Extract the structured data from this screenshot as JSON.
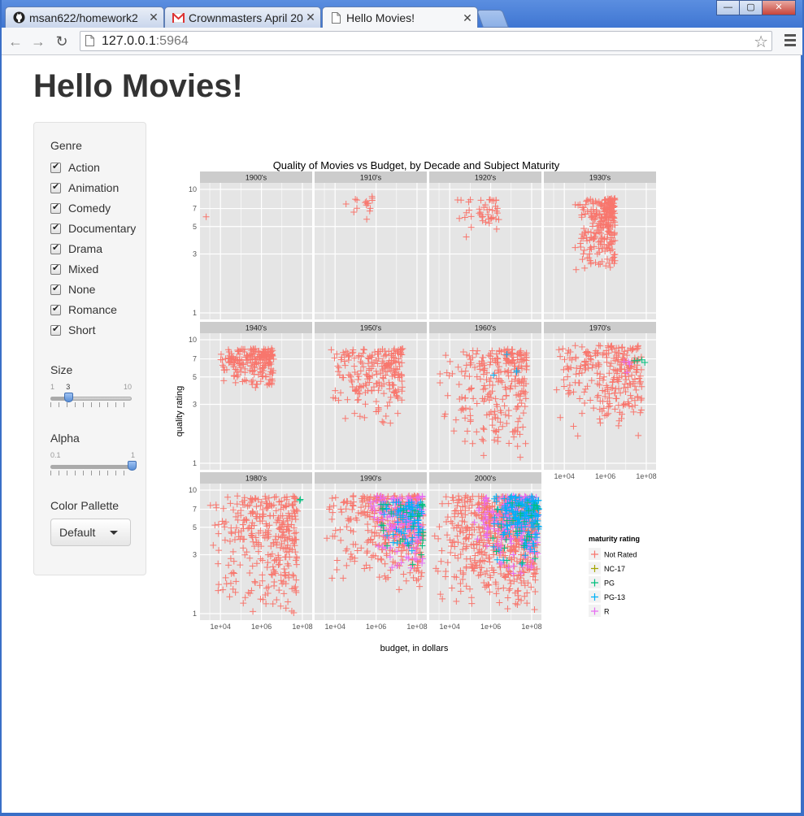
{
  "browser": {
    "tabs": [
      {
        "label": "msan622/homework2",
        "icon": "github-icon"
      },
      {
        "label": "Crownmasters April 20",
        "icon": "gmail-icon"
      },
      {
        "label": "Hello Movies!",
        "icon": "page-icon"
      }
    ],
    "url_host": "127.0.0.1",
    "url_port": ":5964"
  },
  "page": {
    "title": "Hello Movies!"
  },
  "sidebar": {
    "genre_label": "Genre",
    "genres": [
      "Action",
      "Animation",
      "Comedy",
      "Documentary",
      "Drama",
      "Mixed",
      "None",
      "Romance",
      "Short"
    ],
    "size": {
      "label": "Size",
      "min": "1",
      "max": "10",
      "value": "3",
      "fraction": 0.222
    },
    "alpha": {
      "label": "Alpha",
      "min": "0.1",
      "max": "1",
      "value": "1",
      "fraction": 1.0
    },
    "palette": {
      "label": "Color Pallette",
      "selected": "Default"
    }
  },
  "colors": {
    "not_rated": "#f8766d",
    "nc17": "#a3a500",
    "pg": "#00bf7d",
    "pg13": "#00b0f6",
    "r": "#e76bf3",
    "panel_bg": "#e5e5e5",
    "strip_bg": "#cccccc"
  },
  "chart_data": {
    "type": "scatter",
    "title": "Quality of Movies vs Budget, by Decade and Subject Maturity",
    "xlabel": "budget, in dollars",
    "ylabel": "quality rating",
    "x_scale": "log10",
    "y_scale": "log10",
    "xlim": [
      1000,
      300000000
    ],
    "ylim": [
      1,
      10
    ],
    "x_ticks": [
      "1e+04",
      "1e+06",
      "1e+08"
    ],
    "y_ticks": [
      "1",
      "3",
      "5",
      "7",
      "10"
    ],
    "facets": [
      "1900's",
      "1910's",
      "1920's",
      "1930's",
      "1940's",
      "1950's",
      "1960's",
      "1970's",
      "1980's",
      "1990's",
      "2000's"
    ],
    "legend": {
      "title": "maturity rating",
      "entries": [
        "Not Rated",
        "NC-17",
        "PG",
        "PG-13",
        "R"
      ]
    },
    "clusters": [
      {
        "facet": "1900's",
        "rating": "Not Rated",
        "n": 1,
        "x": [
          2000,
          2000
        ],
        "y": [
          6,
          6
        ]
      },
      {
        "facet": "1910's",
        "rating": "Not Rated",
        "n": 16,
        "x": [
          8000,
          800000
        ],
        "y": [
          5,
          9
        ]
      },
      {
        "facet": "1920's",
        "rating": "Not Rated",
        "n": 45,
        "x": [
          20000,
          2500000
        ],
        "y": [
          4,
          8.5
        ]
      },
      {
        "facet": "1930's",
        "rating": "Not Rated",
        "n": 260,
        "x": [
          30000,
          3000000
        ],
        "y": [
          2,
          8.5
        ]
      },
      {
        "facet": "1940's",
        "rating": "Not Rated",
        "n": 220,
        "x": [
          10000,
          4000000
        ],
        "y": [
          4,
          8.5
        ]
      },
      {
        "facet": "1950's",
        "rating": "Not Rated",
        "n": 220,
        "x": [
          4000,
          20000000
        ],
        "y": [
          2,
          8.5
        ]
      },
      {
        "facet": "1960's",
        "rating": "Not Rated",
        "n": 260,
        "x": [
          3000,
          60000000
        ],
        "y": [
          1,
          8.5
        ]
      },
      {
        "facet": "1960's",
        "rating": "PG-13",
        "n": 4,
        "x": [
          100000,
          30000000
        ],
        "y": [
          4,
          8
        ]
      },
      {
        "facet": "1970's",
        "rating": "Not Rated",
        "n": 260,
        "x": [
          3000,
          60000000
        ],
        "y": [
          1.5,
          9
        ]
      },
      {
        "facet": "1970's",
        "rating": "PG",
        "n": 4,
        "x": [
          1000000,
          100000000
        ],
        "y": [
          6,
          7
        ]
      },
      {
        "facet": "1970's",
        "rating": "R",
        "n": 4,
        "x": [
          100000,
          30000000
        ],
        "y": [
          5,
          7
        ]
      },
      {
        "facet": "1980's",
        "rating": "Not Rated",
        "n": 330,
        "x": [
          2000,
          60000000
        ],
        "y": [
          1,
          9
        ]
      },
      {
        "facet": "1980's",
        "rating": "PG",
        "n": 2,
        "x": [
          50000000,
          80000000
        ],
        "y": [
          7,
          8.5
        ]
      },
      {
        "facet": "1990's",
        "rating": "Not Rated",
        "n": 380,
        "x": [
          3000,
          200000000
        ],
        "y": [
          1.5,
          9
        ]
      },
      {
        "facet": "1990's",
        "rating": "R",
        "n": 160,
        "x": [
          500000,
          200000000
        ],
        "y": [
          2,
          9
        ]
      },
      {
        "facet": "1990's",
        "rating": "PG-13",
        "n": 80,
        "x": [
          1000000,
          200000000
        ],
        "y": [
          3,
          8
        ]
      },
      {
        "facet": "1990's",
        "rating": "PG",
        "n": 30,
        "x": [
          1000000,
          200000000
        ],
        "y": [
          2.5,
          8
        ]
      },
      {
        "facet": "2000's",
        "rating": "Not Rated",
        "n": 650,
        "x": [
          1200,
          200000000
        ],
        "y": [
          1,
          9
        ]
      },
      {
        "facet": "2000's",
        "rating": "R",
        "n": 180,
        "x": [
          100000,
          200000000
        ],
        "y": [
          2,
          9
        ]
      },
      {
        "facet": "2000's",
        "rating": "PG-13",
        "n": 170,
        "x": [
          1000000,
          250000000
        ],
        "y": [
          2.5,
          9
        ]
      },
      {
        "facet": "2000's",
        "rating": "PG",
        "n": 30,
        "x": [
          1000000,
          200000000
        ],
        "y": [
          2,
          8
        ]
      }
    ]
  }
}
